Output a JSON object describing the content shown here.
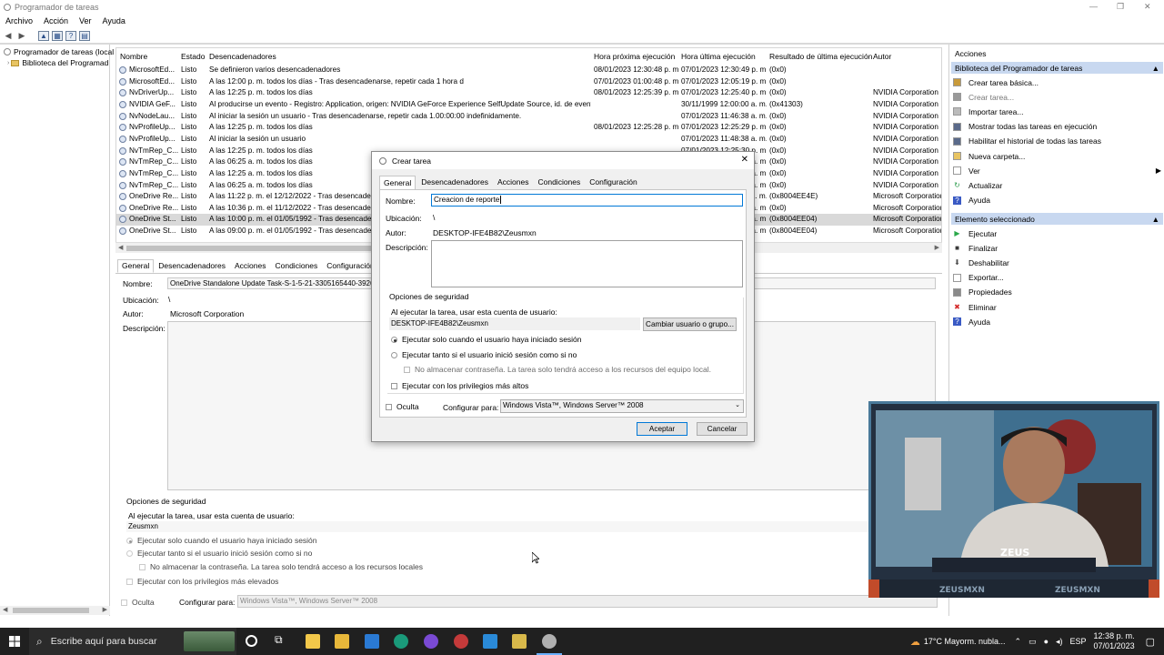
{
  "window": {
    "title": "Programador de tareas"
  },
  "menu": [
    "Archivo",
    "Acción",
    "Ver",
    "Ayuda"
  ],
  "tree": {
    "root": "Programador de tareas (local",
    "child": "Biblioteca del Programad"
  },
  "task_list": {
    "columns": [
      "Nombre",
      "Estado",
      "Desencadenadores",
      "Hora próxima ejecución",
      "Hora última ejecución",
      "Resultado de última ejecución",
      "Autor"
    ],
    "rows": [
      [
        "MicrosoftEd...",
        "Listo",
        "Se definieron varios desencadenadores",
        "08/01/2023 12:30:48 p. m.",
        "07/01/2023 12:30:49 p. m.",
        "(0x0)",
        ""
      ],
      [
        "MicrosoftEd...",
        "Listo",
        "A las 12:00 p. m. todos los días - Tras desencadenarse, repetir cada 1 hora durante 1 día.",
        "07/01/2023 01:00:48 p. m.",
        "07/01/2023 12:05:19 p. m.",
        "(0x0)",
        ""
      ],
      [
        "NvDriverUp...",
        "Listo",
        "A las 12:25 p. m. todos los días",
        "08/01/2023 12:25:39 p. m.",
        "07/01/2023 12:25:40 p. m.",
        "(0x0)",
        "NVIDIA Corporation"
      ],
      [
        "NVIDIA GeF...",
        "Listo",
        "Al producirse un evento - Registro: Application, origen: NVIDIA GeForce Experience SelfUpdate Source, id. de evento: 0",
        "",
        "30/11/1999 12:00:00 a. m.",
        "(0x41303)",
        "NVIDIA Corporation"
      ],
      [
        "NvNodeLau...",
        "Listo",
        "Al iniciar la sesión un usuario - Tras desencadenarse, repetir cada 1.00:00:00 indefinidamente.",
        "",
        "07/01/2023 11:46:38 a. m.",
        "(0x0)",
        "NVIDIA Corporation"
      ],
      [
        "NvProfileUp...",
        "Listo",
        "A las 12:25 p. m. todos los días",
        "08/01/2023 12:25:28 p. m.",
        "07/01/2023 12:25:29 p. m.",
        "(0x0)",
        "NVIDIA Corporation"
      ],
      [
        "NvProfileUp...",
        "Listo",
        "Al iniciar la sesión un usuario",
        "",
        "07/01/2023 11:48:38 a. m.",
        "(0x0)",
        "NVIDIA Corporation"
      ],
      [
        "NvTmRep_C...",
        "Listo",
        "A las 12:25 p. m. todos los días",
        "",
        "07/01/2023 12:25:30 p. m.",
        "(0x0)",
        "NVIDIA Corporation"
      ],
      [
        "NvTmRep_C...",
        "Listo",
        "A las 06:25 a. m. todos los días",
        "",
        "07/01/2023 06:25:00 a. m.",
        "(0x0)",
        "NVIDIA Corporation"
      ],
      [
        "NvTmRep_C...",
        "Listo",
        "A las 12:25 a. m. todos los días",
        "",
        "07/01/2023 12:25:00 a. m.",
        "(0x0)",
        "NVIDIA Corporation"
      ],
      [
        "NvTmRep_C...",
        "Listo",
        "A las 06:25 a. m. todos los días",
        "",
        "07/01/2023 06:25:00 a. m.",
        "(0x0)",
        "NVIDIA Corporation"
      ],
      [
        "OneDrive Re...",
        "Listo",
        "A las 11:22 p. m. el 12/12/2022 - Tras desencadenarse",
        "",
        "07/01/2023 11:22:00 a. m.",
        "(0x8004EE4E)",
        "Microsoft Corporation"
      ],
      [
        "OneDrive Re...",
        "Listo",
        "A las 10:36 p. m. el 11/12/2022 - Tras desencadenarse",
        "",
        "07/01/2023 10:36:00 a. m.",
        "(0x0)",
        "Microsoft Corporation"
      ],
      [
        "OneDrive St...",
        "Listo",
        "A las 10:00 p. m. el 01/05/1992 - Tras desencadenarse",
        "",
        "07/01/2023 10:00:00 a. m.",
        "(0x8004EE04)",
        "Microsoft Corporation"
      ],
      [
        "OneDrive St...",
        "Listo",
        "A las 09:00 p. m. el 01/05/1992 - Tras desencadenarse",
        "",
        "07/01/2023 09:00:00 a. m.",
        "(0x8004EE04)",
        "Microsoft Corporation"
      ]
    ]
  },
  "detail": {
    "tabs": [
      "General",
      "Desencadenadores",
      "Acciones",
      "Condiciones",
      "Configuración",
      "Hi"
    ],
    "name_label": "Nombre:",
    "name_value": "OneDrive Standalone Update Task-S-1-5-21-3305165440-392621",
    "location_label": "Ubicación:",
    "location_value": "\\",
    "author_label": "Autor:",
    "author_value": "Microsoft Corporation",
    "desc_label": "Descripción:",
    "security_title": "Opciones de seguridad",
    "run_as_label": "Al ejecutar la tarea, usar esta cuenta de usuario:",
    "user": "Zeusmxn",
    "opt1": "Ejecutar solo cuando el usuario haya iniciado sesión",
    "opt2": "Ejecutar tanto si el usuario inició sesión como si no",
    "opt3": "No almacenar la contraseña. La tarea solo tendrá acceso a los recursos locales",
    "opt4": "Ejecutar con los privilegios más elevados",
    "hidden_label": "Oculta",
    "config_label": "Configurar para:",
    "config_value": "Windows Vista™, Windows Server™ 2008"
  },
  "actions": {
    "title": "Acciones",
    "section1": "Biblioteca del Programador de tareas",
    "items1": [
      {
        "label": "Crear tarea básica...",
        "icon": "create-basic-task-icon"
      },
      {
        "label": "Crear tarea...",
        "icon": "create-task-icon"
      },
      {
        "label": "Importar tarea...",
        "icon": "import-icon"
      },
      {
        "label": "Mostrar todas las tareas en ejecución",
        "icon": "running-tasks-icon"
      },
      {
        "label": "Habilitar el historial de todas las tareas",
        "icon": "history-icon"
      },
      {
        "label": "Nueva carpeta...",
        "icon": "folder-icon"
      },
      {
        "label": "Ver",
        "icon": "view-icon"
      },
      {
        "label": "Actualizar",
        "icon": "refresh-icon"
      },
      {
        "label": "Ayuda",
        "icon": "help-icon"
      }
    ],
    "section2": "Elemento seleccionado",
    "items2": [
      {
        "label": "Ejecutar",
        "icon": "run-icon"
      },
      {
        "label": "Finalizar",
        "icon": "stop-icon"
      },
      {
        "label": "Deshabilitar",
        "icon": "disable-icon"
      },
      {
        "label": "Exportar...",
        "icon": "export-icon"
      },
      {
        "label": "Propiedades",
        "icon": "properties-icon"
      },
      {
        "label": "Eliminar",
        "icon": "delete-icon"
      },
      {
        "label": "Ayuda",
        "icon": "help-icon"
      }
    ]
  },
  "dialog": {
    "title": "Crear tarea",
    "tabs": [
      "General",
      "Desencadenadores",
      "Acciones",
      "Condiciones",
      "Configuración"
    ],
    "name_label": "Nombre:",
    "name_value": "Creacion de reporte",
    "location_label": "Ubicación:",
    "location_value": "\\",
    "author_label": "Autor:",
    "author_value": "DESKTOP-IFE4B82\\Zeusmxn",
    "desc_label": "Descripción:",
    "security_title": "Opciones de seguridad",
    "run_as_label": "Al ejecutar la tarea, usar esta cuenta de usuario:",
    "user": "DESKTOP-IFE4B82\\Zeusmxn",
    "change_user_button": "Cambiar usuario o grupo...",
    "opt1": "Ejecutar solo cuando el usuario haya iniciado sesión",
    "opt2": "Ejecutar tanto si el usuario inició sesión como si no",
    "opt3": "No almacenar contraseña. La tarea solo tendrá acceso a los recursos del equipo local.",
    "opt4": "Ejecutar con los privilegios más altos",
    "hidden_label": "Oculta",
    "config_label": "Configurar para:",
    "config_value": "Windows Vista™, Windows Server™ 2008",
    "ok": "Aceptar",
    "cancel": "Cancelar"
  },
  "webcam": {
    "name_top": "ZEUS",
    "name_left": "ZEUSMXN",
    "name_right": "ZEUSMXN"
  },
  "taskbar": {
    "search_placeholder": "Escribe aquí para buscar",
    "weather": "17°C  Mayorm. nubla...",
    "lang": "ESP",
    "time": "12:38 p. m.",
    "date": "07/01/2023"
  }
}
